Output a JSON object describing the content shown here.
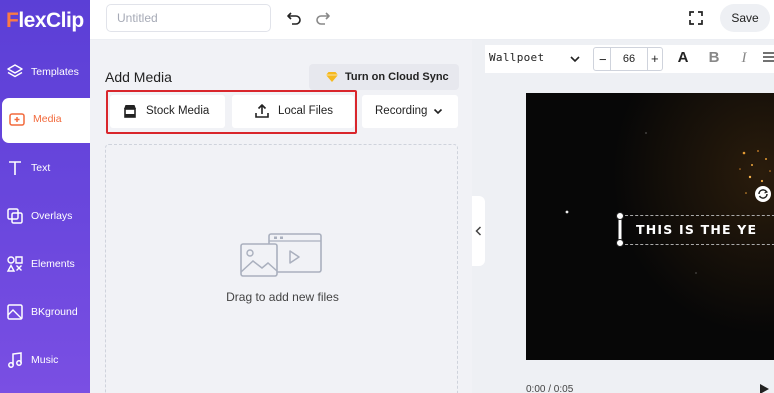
{
  "app": {
    "logo_prefix": "F",
    "logo_text": "lexClip"
  },
  "sidebar": {
    "items": [
      {
        "label": "Templates",
        "icon": "layers-icon",
        "active": false
      },
      {
        "label": "Media",
        "icon": "media-icon",
        "active": true
      },
      {
        "label": "Text",
        "icon": "text-icon",
        "active": false
      },
      {
        "label": "Overlays",
        "icon": "overlays-icon",
        "active": false
      },
      {
        "label": "Elements",
        "icon": "elements-icon",
        "active": false
      },
      {
        "label": "BKground",
        "icon": "background-icon",
        "active": false
      },
      {
        "label": "Music",
        "icon": "music-icon",
        "active": false
      }
    ]
  },
  "topbar": {
    "title_placeholder": "Untitled",
    "save_label": "Save"
  },
  "media_panel": {
    "heading": "Add Media",
    "cloud_sync_label": "Turn on Cloud Sync",
    "stock_media_label": "Stock Media",
    "local_files_label": "Local Files",
    "recording_label": "Recording",
    "dropzone_text": "Drag to add new files"
  },
  "text_toolbar": {
    "font": "Wallpoet",
    "font_size": "66"
  },
  "preview": {
    "overlay_text": "THIS IS THE YE",
    "time": "0:00 / 0:05"
  },
  "colors": {
    "accent": "#6a47dd",
    "active_text": "#f26a3c",
    "highlight": "#d9262c"
  }
}
